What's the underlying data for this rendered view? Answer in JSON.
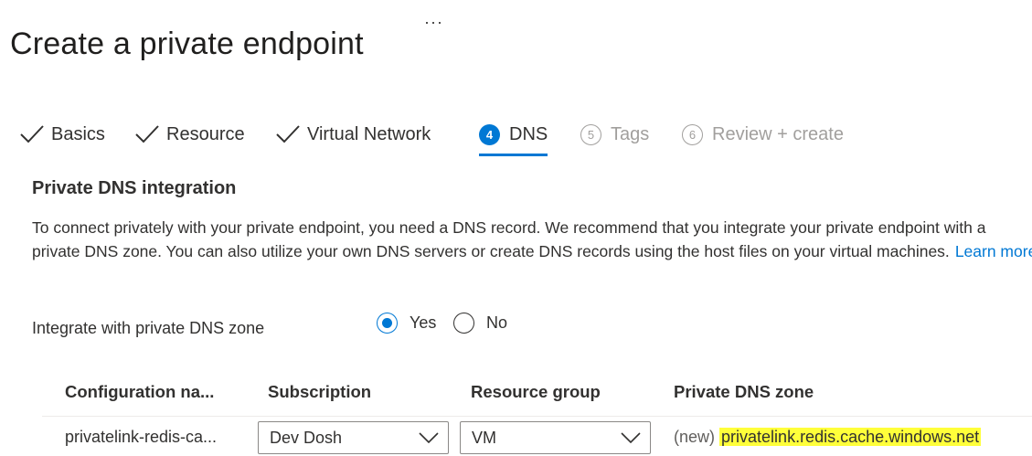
{
  "page": {
    "title": "Create a private endpoint",
    "more_label": "···"
  },
  "tabs": [
    {
      "label": "Basics",
      "state": "done"
    },
    {
      "label": "Resource",
      "state": "done"
    },
    {
      "label": "Virtual Network",
      "state": "done"
    },
    {
      "label": "DNS",
      "number": "4",
      "state": "active"
    },
    {
      "label": "Tags",
      "number": "5",
      "state": "disabled"
    },
    {
      "label": "Review + create",
      "number": "6",
      "state": "disabled"
    }
  ],
  "section": {
    "title": "Private DNS integration",
    "description": "To connect privately with your private endpoint, you need a DNS record. We recommend that you integrate your private endpoint with a private DNS zone. You can also utilize your own DNS servers or create DNS records using the host files on your virtual machines.",
    "learn_more": "Learn more"
  },
  "integrate": {
    "label": "Integrate with private DNS zone",
    "options": [
      "Yes",
      "No"
    ],
    "selected": "Yes"
  },
  "table": {
    "headers": [
      "Configuration na...",
      "Subscription",
      "Resource group",
      "Private DNS zone"
    ],
    "row": {
      "config_name": "privatelink-redis-ca...",
      "subscription": "Dev Dosh",
      "resource_group": "VM",
      "zone_prefix": "(new)",
      "zone_name": "privatelink.redis.cache.windows.net"
    }
  },
  "colors": {
    "accent": "#0078d4",
    "highlight": "#ffff3a",
    "disabled": "#a19f9d"
  }
}
